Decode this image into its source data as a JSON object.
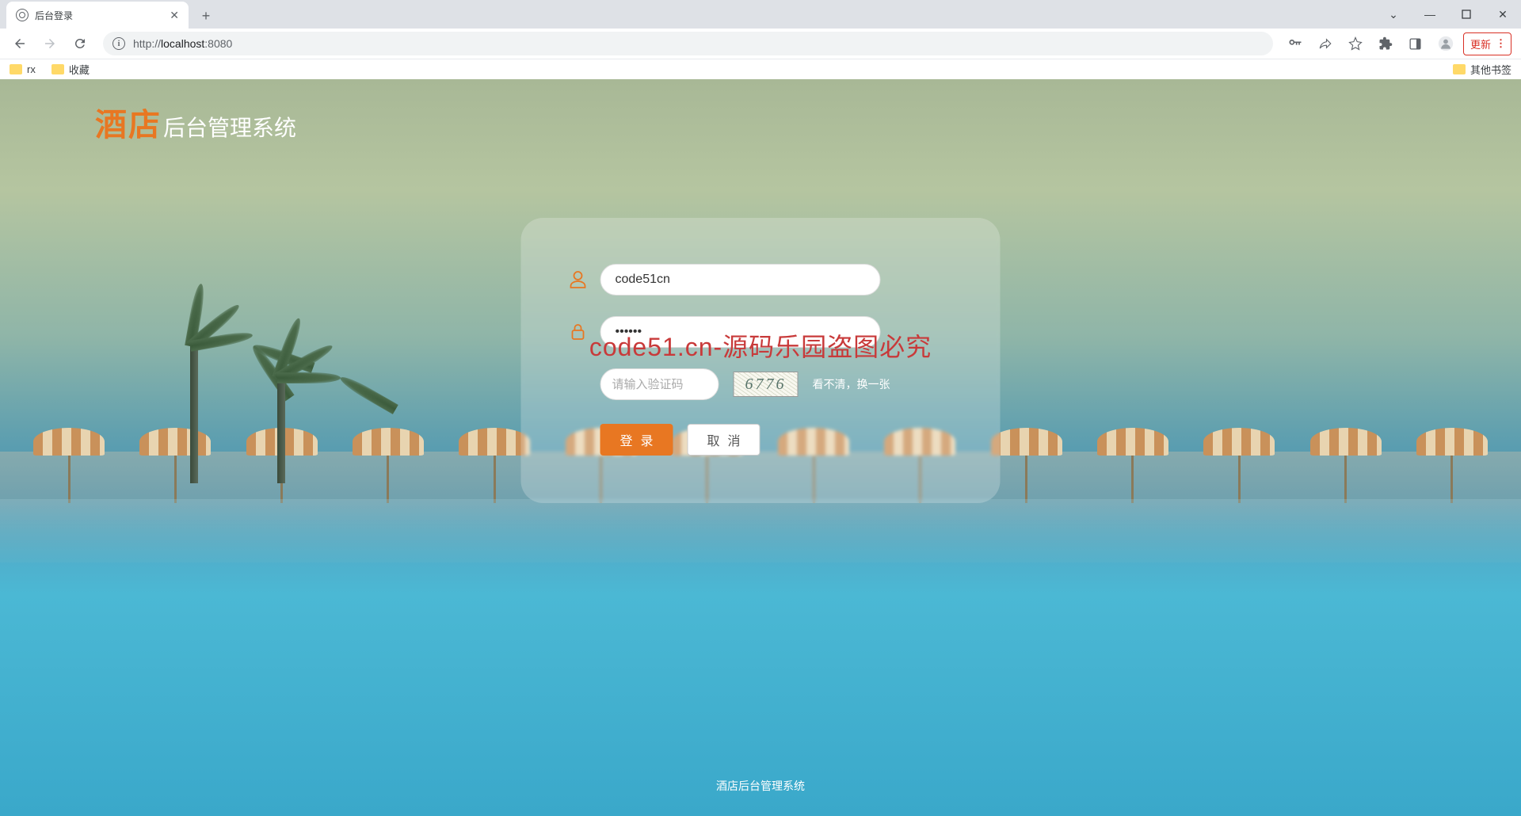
{
  "browser": {
    "tab_title": "后台登录",
    "url_prefix": "http://",
    "url_host": "localhost",
    "url_port": ":8080",
    "bookmarks": [
      "rx",
      "收藏"
    ],
    "other_bookmarks": "其他书签",
    "update_label": "更新"
  },
  "page": {
    "logo_accent": "酒店",
    "logo_rest": "后台管理系统",
    "footer": "酒店后台管理系统",
    "watermark": "code51.cn-源码乐园盗图必究"
  },
  "form": {
    "username_value": "code51cn",
    "password_value": "••••••",
    "captcha_placeholder": "请输入验证码",
    "captcha_code": "6776",
    "captcha_refresh": "看不清，换一张",
    "login_label": "登录",
    "cancel_label": "取消"
  },
  "colors": {
    "accent": "#e87722",
    "watermark": "#c83a3a"
  }
}
